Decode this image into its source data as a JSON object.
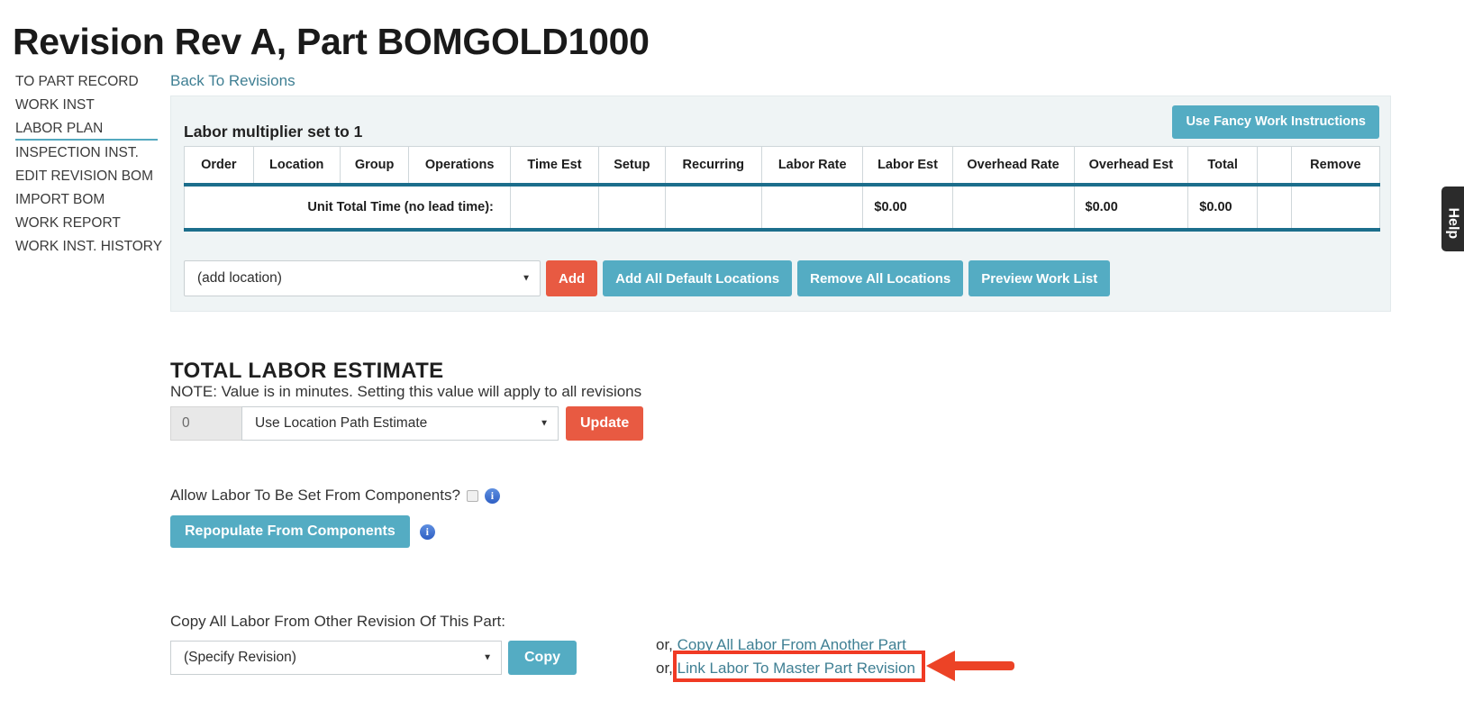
{
  "page": {
    "title": "Revision Rev A, Part BOMGOLD1000"
  },
  "sidenav": {
    "items": [
      {
        "label": "TO PART RECORD",
        "active": false
      },
      {
        "label": "WORK INST",
        "active": false
      },
      {
        "label": "LABOR PLAN",
        "active": true
      },
      {
        "label": "INSPECTION INST.",
        "active": false
      },
      {
        "label": "EDIT REVISION BOM",
        "active": false
      },
      {
        "label": "IMPORT BOM",
        "active": false
      },
      {
        "label": "WORK REPORT",
        "active": false
      },
      {
        "label": "WORK INST. HISTORY",
        "active": false
      }
    ]
  },
  "back_link": "Back To Revisions",
  "panel": {
    "heading": "Labor multiplier set to 1",
    "fancy_button": "Use Fancy Work Instructions"
  },
  "labor_table": {
    "headers": [
      "Order",
      "Location",
      "Group",
      "Operations",
      "Time Est",
      "Setup",
      "Recurring",
      "Labor Rate",
      "Labor Est",
      "Overhead Rate",
      "Overhead Est",
      "Total",
      "",
      "Remove"
    ],
    "total_row": {
      "label": "Unit Total Time (no lead time):",
      "time_est": "",
      "setup": "",
      "recurring": "",
      "labor_rate": "",
      "labor_est": "$0.00",
      "overhead_rate": "",
      "overhead_est": "$0.00",
      "total": "$0.00",
      "spacer": "",
      "remove": ""
    }
  },
  "add_row": {
    "location_select_value": "(add location)",
    "add_button": "Add",
    "add_all_button": "Add All Default Locations",
    "remove_all_button": "Remove All Locations",
    "preview_button": "Preview Work List"
  },
  "total_labor": {
    "section_title": "TOTAL LABOR ESTIMATE",
    "note": "NOTE: Value is in minutes. Setting this value will apply to all revisions",
    "minutes_value": "0",
    "estimate_select_value": "Use Location Path Estimate",
    "update_button": "Update"
  },
  "allow_labor": {
    "label": "Allow Labor To Be Set From Components?",
    "checked": false,
    "info_glyph": "i",
    "repopulate_button": "Repopulate From Components"
  },
  "copy_labor": {
    "label": "Copy All Labor From Other Revision Of This Part:",
    "revision_select_value": "(Specify Revision)",
    "copy_button": "Copy",
    "or_prefix": "or,",
    "or_prefix_2": "or,",
    "link_copy_another_part": "Copy All Labor From Another Part",
    "link_master_part_revision": "Link Labor To Master Part Revision"
  },
  "annotation": {
    "highlight_color": "#f03a24",
    "arrow_color": "#ec4326"
  },
  "help_tab": {
    "label": "Help"
  },
  "colors": {
    "teal_button": "#54acc3",
    "red_button": "#e85a42",
    "table_rule": "#1c6e8c",
    "link": "#3f7f93",
    "panel_bg": "#eff4f5"
  }
}
